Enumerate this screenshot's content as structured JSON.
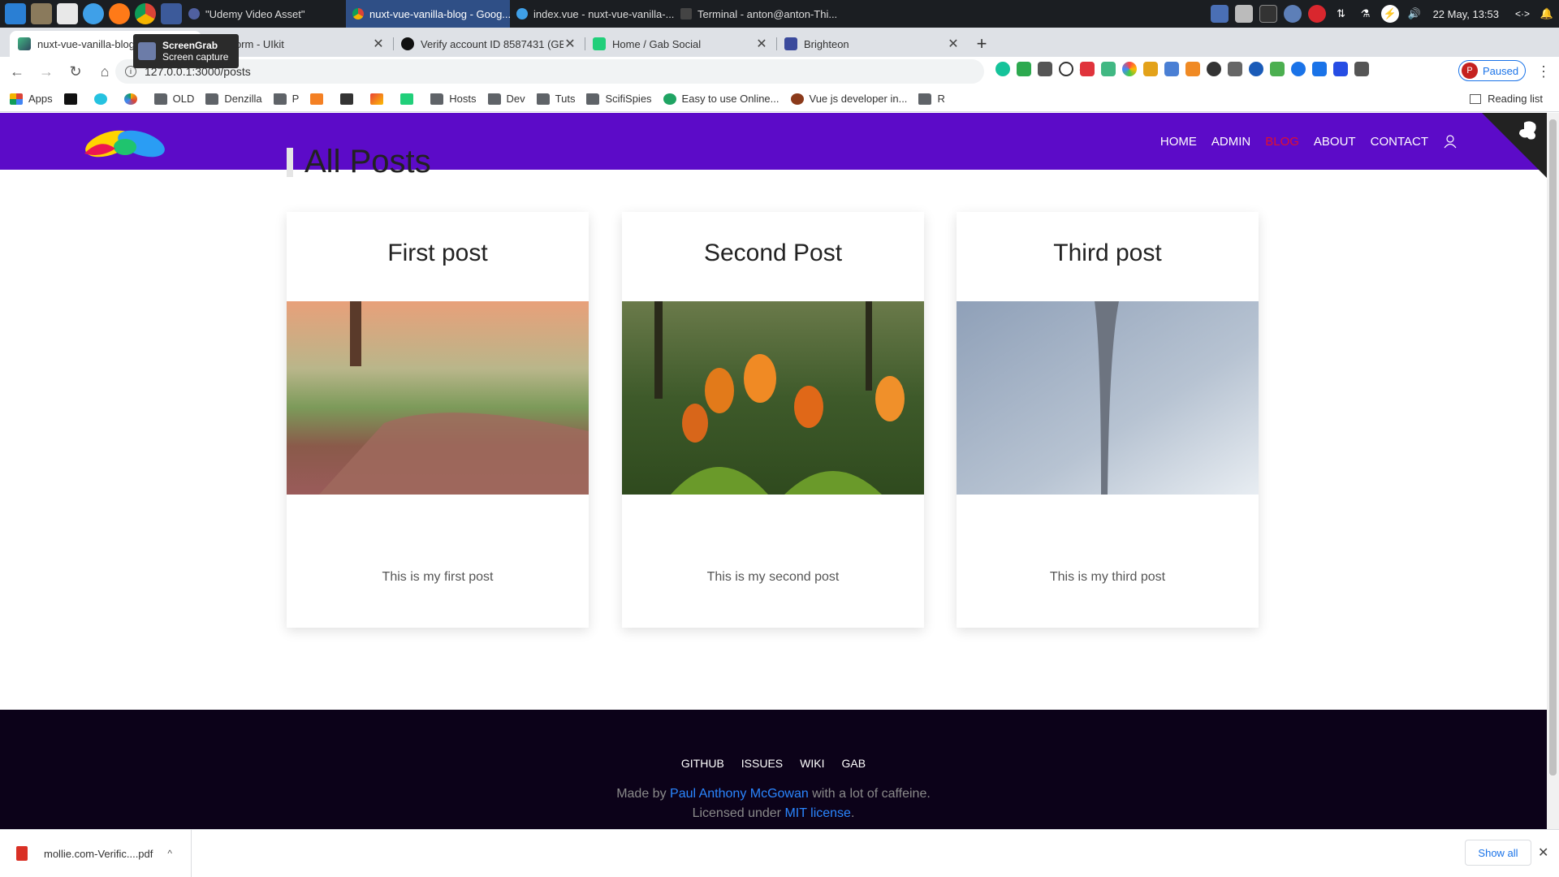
{
  "taskbar": {
    "tasks": [
      {
        "label": "\"Udemy Video Asset\"",
        "active": false
      },
      {
        "label": "nuxt-vue-vanilla-blog - Goog...",
        "active": true
      },
      {
        "label": "index.vue - nuxt-vue-vanilla-...",
        "active": false
      },
      {
        "label": "Terminal - anton@anton-Thi...",
        "active": false
      }
    ],
    "clock": "22 May, 13:53"
  },
  "tooltip": {
    "title": "ScreenGrab",
    "subtitle": "Screen capture"
  },
  "browser_tabs": [
    {
      "label": "nuxt-vue-vanilla-blog",
      "active": true
    },
    {
      "label": "Form - UIkit",
      "active": false
    },
    {
      "label": "Verify account ID 8587431 (GB",
      "active": false
    },
    {
      "label": "Home / Gab Social",
      "active": false
    },
    {
      "label": "Brighteon",
      "active": false
    }
  ],
  "address_bar": {
    "url": "127.0.0.1:3000/posts"
  },
  "profile": {
    "initial": "P",
    "label": "Paused"
  },
  "bookmarks": {
    "items": [
      "Apps",
      "",
      "",
      "",
      "OLD",
      "Denzilla",
      "P",
      "",
      "",
      "",
      "",
      "Hosts",
      "Dev",
      "Tuts",
      "ScifiSpies",
      "Easy to use Online...",
      "Vue js developer in...",
      "R"
    ],
    "reading_list": "Reading list"
  },
  "site": {
    "nav": [
      "HOME",
      "ADMIN",
      "BLOG",
      "ABOUT",
      "CONTACT"
    ],
    "active_nav": "BLOG",
    "page_title": "All Posts",
    "posts": [
      {
        "title": "First post",
        "excerpt": "This is my first post"
      },
      {
        "title": "Second Post",
        "excerpt": "This is my second post"
      },
      {
        "title": "Third post",
        "excerpt": "This is my third post"
      }
    ],
    "footer": {
      "links": [
        "GITHUB",
        "ISSUES",
        "WIKI",
        "GAB"
      ],
      "made_by_prefix": "Made by ",
      "author": "Paul Anthony McGowan",
      "made_by_suffix": " with a lot of caffeine.",
      "license_prefix": "Licensed under ",
      "license": "MIT license",
      "license_suffix": "."
    },
    "colors": {
      "navbar": "#5c0bc8",
      "active_link": "#e0102f",
      "footer": "#0c0219",
      "link": "#2a86ff"
    }
  },
  "downloads": {
    "file": "mollie.com-Verific....pdf",
    "show_all": "Show all"
  }
}
